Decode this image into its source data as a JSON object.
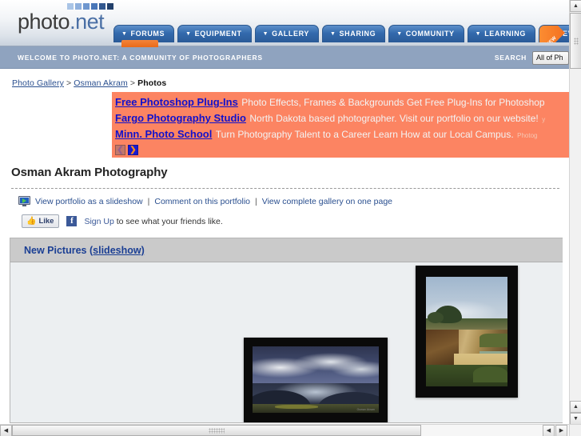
{
  "header": {
    "logo_text_primary": "photo",
    "logo_text_accent": ".net",
    "logo_dot_colors": [
      "#a9c4e6",
      "#8fb0dd",
      "#6f97cf",
      "#4a77b8",
      "#33588f",
      "#23406b"
    ],
    "nav_tabs": [
      {
        "label": "FORUMS",
        "caret": "▼",
        "badge": ""
      },
      {
        "label": "EQUIPMENT",
        "caret": "▼",
        "badge": ""
      },
      {
        "label": "GALLERY",
        "caret": "▼",
        "badge": ""
      },
      {
        "label": "SHARING",
        "caret": "▼",
        "badge": ""
      },
      {
        "label": "COMMUNITY",
        "caret": "▼",
        "badge": ""
      },
      {
        "label": "LEARNING",
        "caret": "▼",
        "badge": ""
      },
      {
        "label": "REVIEWS",
        "caret": "",
        "badge": "NEW"
      }
    ]
  },
  "welcome": {
    "text": "WELCOME TO PHOTO.NET: A COMMUNITY OF PHOTOGRAPHERS",
    "search_label": "SEARCH",
    "search_scope_selected": "All of Ph"
  },
  "breadcrumb": {
    "item1": "Photo Gallery",
    "sep1": ">",
    "item2": "Osman Akram",
    "sep2": ">",
    "current": "Photos"
  },
  "ads": [
    {
      "title": "Free Photoshop Plug-Ins",
      "description": "Photo Effects, Frames & Backgrounds Get Free Plug-Ins for Photoshop",
      "extra": ""
    },
    {
      "title": "Fargo Photography Studio",
      "description": "North Dakota based photographer. Visit our portfolio on our website!",
      "extra": "y"
    },
    {
      "title": "Minn. Photo School",
      "description": "Turn Photography Talent to a Career Learn How at our Local Campus.",
      "extra": "Photog"
    }
  ],
  "ad_nav": {
    "prev": "❮",
    "next": "❯"
  },
  "portfolio": {
    "title": "Osman Akram Photography",
    "links": [
      "View portfolio as a slideshow",
      "Comment on this portfolio",
      "View complete gallery on one page"
    ],
    "link_separator": "|"
  },
  "facebook": {
    "like_label": "Like",
    "thumb_glyph": "👍",
    "f_glyph": "f",
    "signup_link": "Sign Up",
    "signup_rest": " to see what your friends like."
  },
  "gallery": {
    "heading_main": "New Pictures",
    "heading_link": "(slideshow)",
    "photos": [
      {
        "name": "stormy-hills-landscape",
        "caption": "Osman Akram",
        "orientation": "landscape"
      },
      {
        "name": "coastal-cliff-beach",
        "caption": "",
        "orientation": "portrait"
      }
    ]
  },
  "scrollbars": {
    "up_arrow": "▲",
    "down_arrow": "▼",
    "left_arrow": "◀",
    "right_arrow": "▶"
  },
  "colors": {
    "nav_blue": "#336aad",
    "welcome_bar": "#8fa3bf",
    "ad_background": "#fc8462",
    "link_blue": "#2a4f8f",
    "heading_blue": "#1b3f94",
    "new_badge_orange": "#f4711f"
  }
}
